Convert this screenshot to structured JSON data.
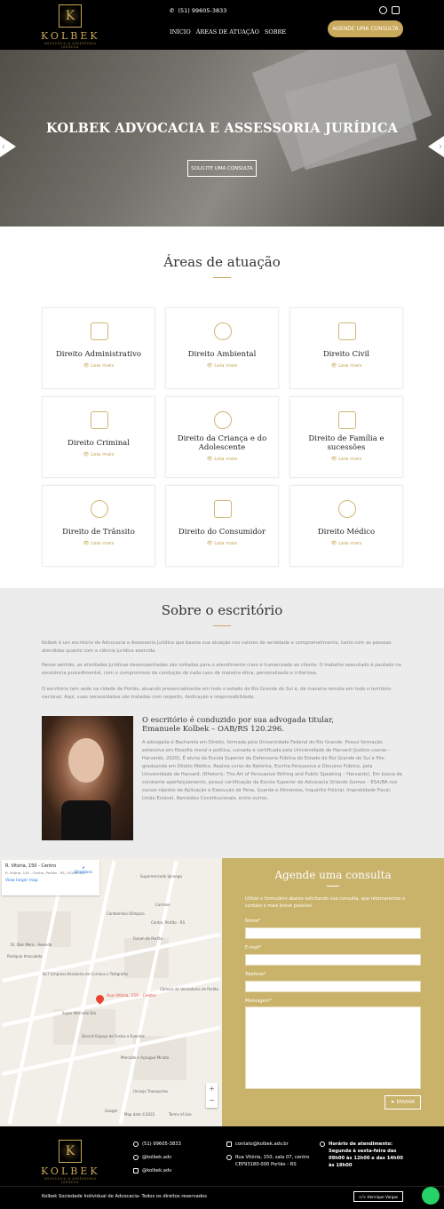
{
  "header": {
    "brand": "KOLBEK",
    "brand_sub": "ADVOCACIA & ASSESSORIA JURÍDICA",
    "logo_letter": "K",
    "phone": "(51) 99605-3833",
    "nav": [
      "INÍCIO",
      "ÁREAS DE ATUAÇÃO",
      "SOBRE"
    ],
    "cta": "AGENDE UMA CONSULTA"
  },
  "hero": {
    "title": "KOLBEK ADVOCACIA E ASSESSORIA JURÍDICA",
    "button": "SOLICITE UMA CONSULTA"
  },
  "areas": {
    "title": "Áreas de atuação",
    "read_more": "Leia mais",
    "items": [
      {
        "title": "Direito Administrativo",
        "icon": "admin-icon"
      },
      {
        "title": "Direito Ambiental",
        "icon": "plant-icon"
      },
      {
        "title": "Direito Civil",
        "icon": "document-icon"
      },
      {
        "title": "Direito Criminal",
        "icon": "criminal-icon"
      },
      {
        "title": "Direito da Criança e do Adolescente",
        "icon": "children-icon"
      },
      {
        "title": "Direito de Família e sucessões",
        "icon": "family-icon"
      },
      {
        "title": "Direito de Trânsito",
        "icon": "traffic-icon"
      },
      {
        "title": "Direito do Consumidor",
        "icon": "consumer-icon"
      },
      {
        "title": "Direito Médico",
        "icon": "doctor-icon"
      }
    ]
  },
  "about": {
    "title": "Sobre o escritório",
    "paragraphs": [
      "Kolbek é um escritório de Advocacia e Assessoria Jurídica que baseia sua atuação nos valores de seriedade e comprometimento, tanto com as pessoas atendidas quanto com a ciência jurídica exercida.",
      "Nesse sentido, as atividades jurídicas desempenhadas são voltadas para o atendimento claro e humanizado ao cliente. O trabalho executado é pautado na excelência procedimental, com o compromisso da condução de cada caso de maneira ética, personalizada e criteriosa.",
      "O escritório tem sede na cidade de Portão, atuando presencialmente em todo o estado do Rio Grande do Sul e, de maneira remota em todo o território nacional. Aqui, suas necessidades são tratadas com respeito, dedicação e responsabilidade."
    ],
    "lawyer_heading": "O escritório é conduzido por sua advogada titular,",
    "lawyer_name": "Emanuele Kolbek – OAB/RS 120.296.",
    "lawyer_bio": "A advogada é Bacharela em Direito, formada pela Universidade Federal do Rio Grande. Possui formação extensiva em filosofia moral e política, cursada e certificada pela Universidade de Harvard (Justice course – Harvardx, 2020). É aluna da Escola Superior da Defensoria Pública do Estado do Rio Grande do Sul e Pós-graduanda em Direito Médico. Realiza curso de Retórica, Escrita Persuasiva e Discurso Público, pela Universidade de Harvard. (Rhetoric: The Art of Persuasive Writing and Public Speaking – Harvardx). Em busca de constante aperfeiçoamento, possui certificação da Escola Superior de Advocacia Orlando Gomes – ESA/BA nos cursos rápidos de Aplicação e Execução de Pena, Guarda e Alimentos, Inquérito Policial, Improbidade Fiscal, União Estável, Remédios Constitucionais, entre outros."
  },
  "map": {
    "address": "R. Vitória, 150 - Centro",
    "address_full": "R. Vitória, 150 - Centro, Portão - RS, 93180-000",
    "directions": "Directions",
    "larger": "View larger map",
    "pin_label": "Rua Vitória, 150 - Centro",
    "labels": [
      "Supermercado Ipiranga",
      "Correios",
      "Condomínio Olímpico",
      "Dr. Dier Mero - Avenida",
      "Paróquia Imaculada",
      "Forum de Portão",
      "Centro, Portão - RS",
      "BCT Empresa Brasileira de Correios e Telégrafos",
      "Câmara de Vereadores de Portão",
      "Super Mercado Dia",
      "Dorsch Espaço de Festas e Eventos",
      "Mercado e Açougue Minato",
      "Unisoja Transportes",
      "Google",
      "Map data ©2022",
      "Terms of Use"
    ]
  },
  "form": {
    "title": "Agende uma consulta",
    "intro": "Utilize o formulário abaixo solicitando sua consulta, que retornaremos o contato o mais breve possível.",
    "name_label": "Nome*",
    "email_label": "E-mail*",
    "phone_label": "Telefone*",
    "message_label": "Mensagem*",
    "submit": "ENVIAR"
  },
  "footer": {
    "phone": "(51) 99605-3833",
    "facebook": "@kolbek.adv",
    "instagram": "@kolbek.adv",
    "email": "contato@kolbek.adv.br",
    "address": "Rua Vitória, 150, sala 07, centro CEP93180-000 Portão - RS",
    "hours_title": "Horário de atendimento:",
    "hours": "Segunda à sexta-feira das 09h00 às 12h00 e das 14h00 às 18h00",
    "copyright": "Kolbek Sociedade Individual de Advocacia- Todos os direitos reservados",
    "developer": "</> Henrique Vargas"
  }
}
